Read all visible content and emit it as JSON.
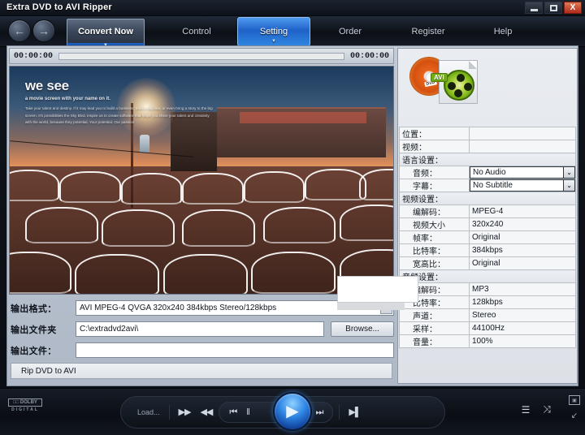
{
  "window": {
    "title": "Extra DVD to AVI Ripper",
    "minimize_label": "minimize",
    "maximize_label": "maximize",
    "close_label": "X"
  },
  "nav": {
    "back_icon": "←",
    "forward_icon": "→",
    "convert_button": "Convert Now",
    "convert_caret": "▼",
    "tabs": [
      {
        "label": "Control",
        "active": false
      },
      {
        "label": "Setting",
        "active": true
      },
      {
        "label": "Order",
        "active": false
      },
      {
        "label": "Register",
        "active": false
      },
      {
        "label": "Help",
        "active": false
      }
    ],
    "active_tab_caret": "▼"
  },
  "player_timeline": {
    "current_time": "00:00:00",
    "total_time": "00:00:00"
  },
  "preview": {
    "headline": "we see",
    "subhead": "a movie screen with your name on it.",
    "body": "Take your talent and destiny. If it may lead you to build a business, tend a daytime, or even bring a story to the big screen. It's possibilities the Sky Blvd. inspire us to create software that helps you shine your talent and creativity with the world, because they potential. Your potential. Our passion."
  },
  "output": {
    "format_label": "输出格式：",
    "format_value": "AVI  MPEG-4 QVGA 320x240 384kbps   Stereo/128kbps",
    "folder_label": "输出文件夹",
    "folder_value": "C:\\extradvd2avi\\",
    "file_label": "输出文件：",
    "file_value": "",
    "browse_button": "Browse...",
    "dropdown_caret": "⌄"
  },
  "status": {
    "text": "Rip DVD to AVI"
  },
  "info_panel": {
    "position_label": "位置：",
    "position_value": "",
    "video_label": "视频：",
    "video_value": "",
    "language_section": "语言设置：",
    "audio_label": "音频：",
    "audio_value": "No Audio",
    "subtitle_label": "字幕：",
    "subtitle_value": "No Subtitle",
    "video_section": "视频设置：",
    "video_rows": [
      {
        "label": "编解码：",
        "value": "MPEG-4"
      },
      {
        "label": "视频大小",
        "value": "320x240"
      },
      {
        "label": "帧率：",
        "value": "Original"
      },
      {
        "label": "比特率：",
        "value": "384kbps"
      },
      {
        "label": "宽高比：",
        "value": "Original"
      }
    ],
    "audio_section": "音频设置：",
    "audio_rows": [
      {
        "label": "编解码：",
        "value": "MP3"
      },
      {
        "label": "比特率：",
        "value": "128kbps"
      },
      {
        "label": "声道：",
        "value": "Stereo"
      },
      {
        "label": "采样：",
        "value": "44100Hz"
      },
      {
        "label": "音量：",
        "value": "100%"
      }
    ],
    "dropdown_caret": "⌄",
    "dvd_badge": "DVD",
    "avi_badge": "AVI"
  },
  "transport": {
    "dolby_box": "□□ DOLBY",
    "dolby_word": "DIGITAL",
    "load_button": "Load...",
    "fast_forward": "▶▶",
    "rewind": "◀◀",
    "prev_track": "⏮",
    "pause": "‖",
    "play": "▶",
    "stop": "■",
    "next_track": "⏭",
    "skip_end": "▶▌",
    "playlist_icon": "☰",
    "shuffle_icon": "⤨",
    "screen_icon": "▣",
    "resize_icon": "↙"
  }
}
